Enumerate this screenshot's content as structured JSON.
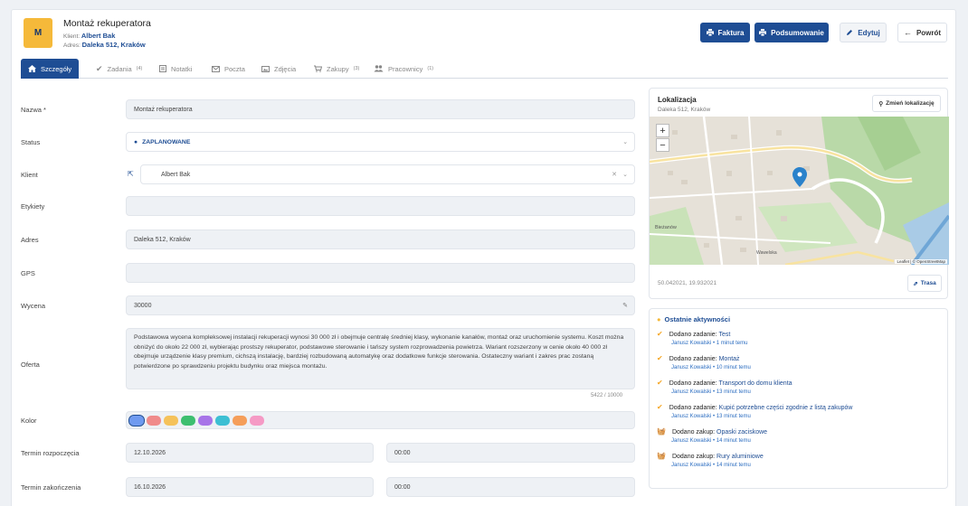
{
  "header": {
    "logo_letter": "M",
    "title": "Montaż rekuperatora",
    "client_label": "Klient:",
    "client_name": "Albert Bak",
    "address_label": "Adres:",
    "address_value": "Daleka 512, Kraków"
  },
  "toolbar": {
    "invoice": "Faktura",
    "summary": "Podsumowanie",
    "edit": "Edytuj",
    "back": "Powrót"
  },
  "tabs": [
    {
      "label": "Szczegóły",
      "count": ""
    },
    {
      "label": "Zadania",
      "count": "(4)"
    },
    {
      "label": "Notatki",
      "count": ""
    },
    {
      "label": "Poczta",
      "count": ""
    },
    {
      "label": "Zdjęcia",
      "count": ""
    },
    {
      "label": "Zakupy",
      "count": "(3)"
    },
    {
      "label": "Pracownicy",
      "count": "(1)"
    }
  ],
  "form": {
    "name_label": "Nazwa *",
    "name_value": "Montaż rekuperatora",
    "status_label": "Status",
    "status_value": "ZAPLANOWANE",
    "client_label": "Klient",
    "client_value": "Albert Bak",
    "tags_label": "Etykiety",
    "tags_value": "",
    "address_label": "Adres",
    "address_value": "Daleka 512, Kraków",
    "gps_label": "GPS",
    "gps_value": "",
    "price_label": "Wycena",
    "price_value": "30000",
    "offer_label": "Oferta",
    "offer_value": "Podstawowa wycena kompleksowej instalacji rekuperacji wynosi 30 000 zł i obejmuje centralę średniej klasy, wykonanie kanałów, montaż oraz uruchomienie systemu. Koszt można obniżyć do około 22 000 zł, wybierając prostszy rekuperator, podstawowe sterowanie i tańszy system rozprowadzenia powietrza. Wariant rozszerzony w cenie około 40 000 zł obejmuje urządzenie klasy premium, cichszą instalację, bardziej rozbudowaną automatykę oraz dodatkowe funkcje sterowania. Ostateczny wariant i zakres prac zostaną potwierdzone po sprawdzeniu projektu budynku oraz miejsca montażu.",
    "offer_counter": "5422 / 10000",
    "color_label": "Kolor",
    "colors": [
      "#6f9af0",
      "#f08b8b",
      "#f5c25a",
      "#3dbf70",
      "#a774e8",
      "#3dbfd3",
      "#f59e5a",
      "#f59ac5"
    ],
    "start_label": "Termin rozpoczęcia",
    "start_date": "12.10.2026",
    "start_time": "00:00",
    "end_label": "Termin zakończenia",
    "end_date": "16.10.2026",
    "end_time": "00:00"
  },
  "location": {
    "title": "Lokalizacja",
    "address": "Daleka 512, Kraków",
    "change_button": "Zmień lokalizację",
    "zoom_in": "+",
    "zoom_out": "−",
    "coords": "50.042021, 19.932021",
    "route_button": "Trasa",
    "attribution": "Leaflet | © OpenStreetMap",
    "map_labels": [
      "Bieżanów",
      "Wawelska"
    ]
  },
  "activity": {
    "title": "Ostatnie aktywności",
    "items": [
      {
        "action": "Dodano zadanie:",
        "subject": "Test",
        "user": "Janusz Kowalski",
        "time": "1 minut temu",
        "type": "task"
      },
      {
        "action": "Dodano zadanie:",
        "subject": "Montaż",
        "user": "Janusz Kowalski",
        "time": "10 minut temu",
        "type": "task"
      },
      {
        "action": "Dodano zadanie:",
        "subject": "Transport do domu klienta",
        "user": "Janusz Kowalski",
        "time": "13 minut temu",
        "type": "task"
      },
      {
        "action": "Dodano zadanie:",
        "subject": "Kupić potrzebne części zgodnie z listą zakupów",
        "user": "Janusz Kowalski",
        "time": "13 minut temu",
        "type": "task"
      },
      {
        "action": "Dodano zakup:",
        "subject": "Opaski zaciskowe",
        "user": "Janusz Kowalski",
        "time": "14 minut temu",
        "type": "purchase"
      },
      {
        "action": "Dodano zakup:",
        "subject": "Rury aluminiowe",
        "user": "Janusz Kowalski",
        "time": "14 minut temu",
        "type": "purchase"
      }
    ]
  }
}
